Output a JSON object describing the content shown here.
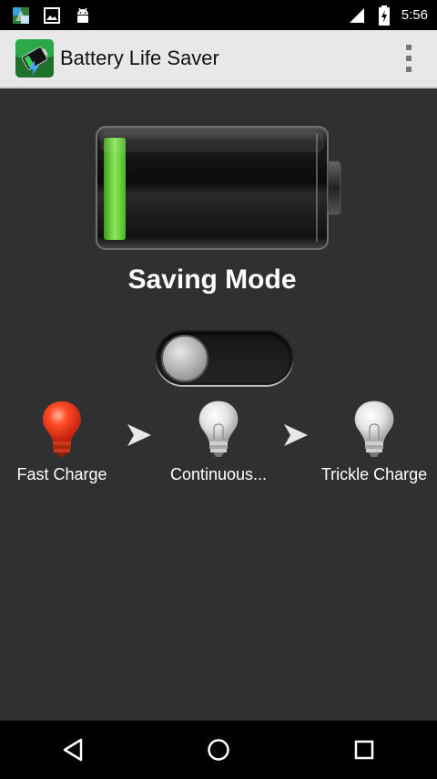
{
  "status_bar": {
    "time": "5:56",
    "left_icons": [
      "app-thumbnail-icon",
      "image-icon",
      "android-icon"
    ],
    "right_icons": [
      "signal-icon",
      "battery-charging-icon"
    ]
  },
  "action_bar": {
    "title": "Battery Life Saver",
    "icon": "battery-app-icon",
    "menu_icon": "overflow-menu-icon"
  },
  "battery": {
    "level_fraction": 0.1,
    "fill_color": "#6fd43a"
  },
  "mode": {
    "title": "Saving Mode",
    "toggle_on": false
  },
  "stages": [
    {
      "label": "Fast Charge",
      "active": true,
      "color": "#e8391e"
    },
    {
      "label": "Continuous...",
      "active": false,
      "color": "#e6e6e6"
    },
    {
      "label": "Trickle Charge",
      "active": false,
      "color": "#e6e6e6"
    }
  ],
  "nav_bar": {
    "buttons": [
      "back-icon",
      "home-icon",
      "recents-icon"
    ]
  }
}
